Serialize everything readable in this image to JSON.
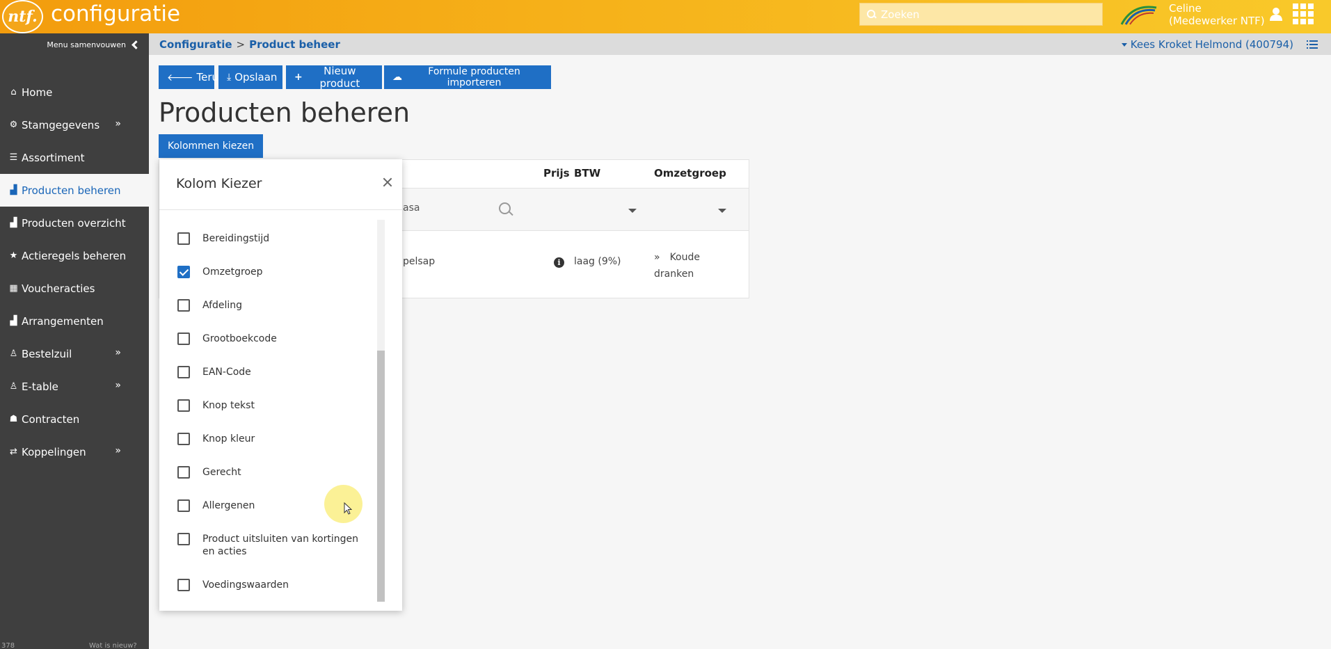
{
  "header": {
    "logo_text": "ntf.",
    "app_title": "configuratie",
    "search_placeholder": "Zoeken",
    "user_name": "Celine",
    "user_role": "(Medewerker NTF)"
  },
  "sidebar": {
    "collapse_label": "Menu samenvouwen",
    "items": [
      {
        "label": "Home",
        "icon": "home-icon",
        "glyph": "⌂",
        "more": ""
      },
      {
        "label": "Stamgegevens",
        "icon": "gear-icon",
        "glyph": "⚙",
        "more": "»"
      },
      {
        "label": "Assortiment",
        "icon": "list-icon",
        "glyph": "☰",
        "more": ""
      },
      {
        "label": "Producten beheren",
        "icon": "products-icon",
        "glyph": "▟",
        "more": ""
      },
      {
        "label": "Producten overzicht",
        "icon": "products-icon",
        "glyph": "▟",
        "more": ""
      },
      {
        "label": "Actieregels beheren",
        "icon": "star-icon",
        "glyph": "★",
        "more": ""
      },
      {
        "label": "Voucheracties",
        "icon": "grid-icon",
        "glyph": "▦",
        "more": ""
      },
      {
        "label": "Arrangementen",
        "icon": "products-icon",
        "glyph": "▟",
        "more": ""
      },
      {
        "label": "Bestelzuil",
        "icon": "kiosk-icon",
        "glyph": "♙",
        "more": "»"
      },
      {
        "label": "E-table",
        "icon": "kiosk-icon",
        "glyph": "♙",
        "more": "»"
      },
      {
        "label": "Contracten",
        "icon": "users-icon",
        "glyph": "☗",
        "more": ""
      },
      {
        "label": "Koppelingen",
        "icon": "retweet-icon",
        "glyph": "⇄",
        "more": "»"
      }
    ],
    "active_index": 3,
    "footer_left": "378",
    "footer_right": "Wat is nieuw?"
  },
  "breadcrumb": {
    "parent": "Configuratie",
    "separator": ">",
    "current": "Product beheer",
    "location": "Kees Kroket Helmond (400794)"
  },
  "toolbar": {
    "back": "Terug",
    "save": "Opslaan",
    "new_product": "Nieuw product",
    "import": "Formule producten importeren"
  },
  "page_title": "Producten beheren",
  "choose_columns": "Kolommen kiezen",
  "table": {
    "headers": {
      "price": "Prijs",
      "vat": "BTW",
      "revenue_group": "Omzetgroep"
    },
    "filter_name": "asa",
    "row": {
      "name": "pelsap",
      "vat": "laag (9%)",
      "revenue_group_marker": "»",
      "revenue_group_line1": "Koude",
      "revenue_group_line2": "dranken"
    }
  },
  "column_picker": {
    "title": "Kolom Kiezer",
    "options": [
      {
        "label": "Bereidingstijd",
        "checked": false
      },
      {
        "label": "Omzetgroep",
        "checked": true
      },
      {
        "label": "Afdeling",
        "checked": false
      },
      {
        "label": "Grootboekcode",
        "checked": false
      },
      {
        "label": "EAN-Code",
        "checked": false
      },
      {
        "label": "Knop tekst",
        "checked": false
      },
      {
        "label": "Knop kleur",
        "checked": false
      },
      {
        "label": "Gerecht",
        "checked": false
      },
      {
        "label": "Allergenen",
        "checked": false
      },
      {
        "label": "Product uitsluiten van kortingen en acties",
        "checked": false
      },
      {
        "label": "Voedingswaarden",
        "checked": false
      }
    ]
  },
  "colors": {
    "accent": "#1f6fc5",
    "topbar": "#f6b21a",
    "sidebar": "#3f3f3f"
  }
}
